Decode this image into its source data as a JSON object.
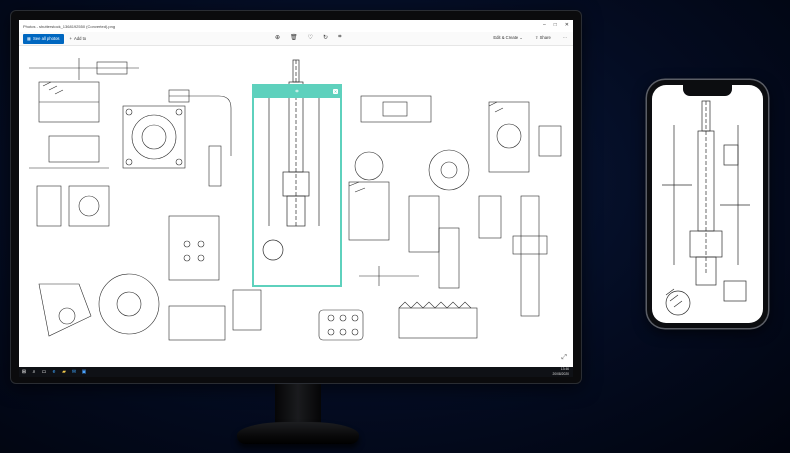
{
  "window": {
    "title": "Photos - shutterstock_1368192550 (Converted).png",
    "minimize_icon": "minimize-icon",
    "maximize_icon": "maximize-icon",
    "close_icon": "close-icon"
  },
  "toolbar": {
    "see_all_label": "See all photos",
    "add_to_label": "Add to",
    "edit_create_label": "Edit & Create",
    "share_label": "Share",
    "more_label": "···",
    "center_icons": [
      "zoom-icon",
      "delete-icon",
      "favorite-icon",
      "rotate-icon",
      "crop-icon"
    ]
  },
  "crop": {
    "handle_icon": "crop-icon",
    "accent_color": "#5ed1bd"
  },
  "taskbar": {
    "time": "13:46",
    "date": "20/08/2020",
    "icons": [
      "windows-icon",
      "search-icon",
      "task-view-icon",
      "edge-icon",
      "explorer-icon",
      "mail-icon",
      "photos-icon"
    ]
  },
  "colors": {
    "see_all_button": "#0067c0",
    "crop_border": "#5ed1bd",
    "background": "#040c22"
  }
}
